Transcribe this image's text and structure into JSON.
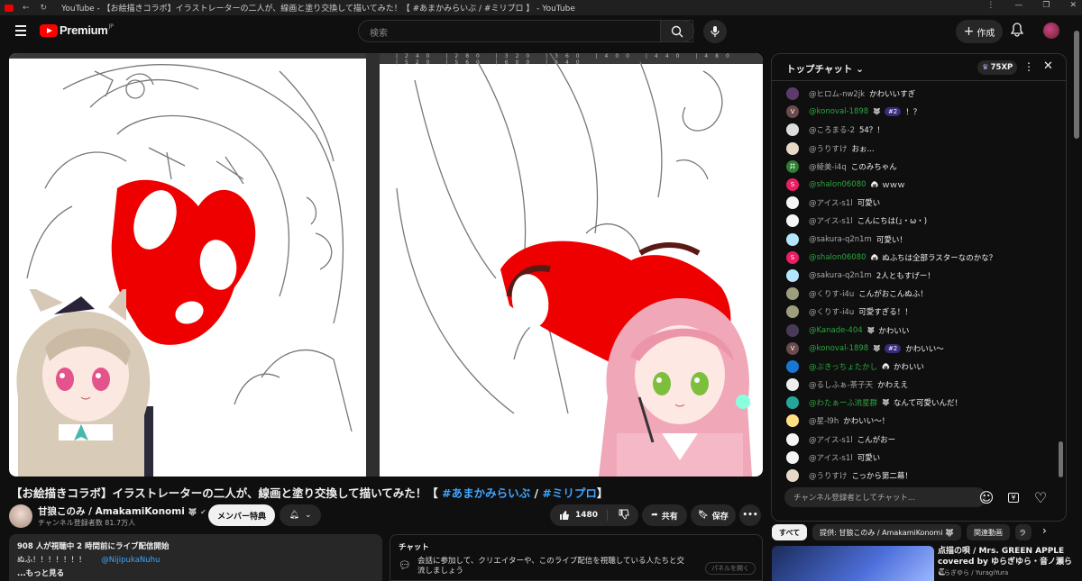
{
  "browser": {
    "tab_title": "YouTube - 【お絵描きコラボ】イラストレーターの二人が、線画と塗り交換して描いてみた！【 #あまかみらいぶ / #ミリプロ 】 - YouTube"
  },
  "header": {
    "logo_text": "Premium",
    "logo_region": "JP",
    "search_placeholder": "検索",
    "create_label": "作成"
  },
  "video": {
    "title_main": "【お絵描きコラボ】イラストレーターの二人が、線画と塗り交換して描いてみた！【",
    "title_tag1": "#あまかみらいぶ",
    "title_sep": " / ",
    "title_tag2": "#ミリプロ",
    "title_end": "】",
    "ruler_labels": "|240 |280 |320 |360 |400 |440 |480 |520 |560 |600 |640"
  },
  "channel": {
    "name": "甘狼このみ / AmakamiKonomi",
    "subs": "チャンネル登録者数 81.7万人",
    "member_label": "メンバー特典"
  },
  "actions": {
    "likes": "1480",
    "share": "共有",
    "save": "保存"
  },
  "description": {
    "live_line": "908 人が視聴中  2 時間前にライブ配信開始",
    "text": "ぬふ！！！！！！！",
    "mention": "@NijipukaNuhu",
    "more": "...もっと見る"
  },
  "chat_panel": {
    "title": "チャット",
    "message": "会話に参加して、クリエイターや、このライブ配信を視聴している人たちと交流しましょう",
    "open_label": "パネルを開く"
  },
  "live_chat": {
    "title": "トップチャット",
    "xp": "75XP",
    "input_placeholder": "チャンネル登録者としてチャット...",
    "messages": [
      {
        "author": "@ヒロム-nw2jk",
        "text": "かわいいすぎ",
        "member": false,
        "badge": "",
        "rank": "",
        "avatar_color": "#5a3b6b",
        "initial": ""
      },
      {
        "author": "@konoval-1898",
        "text": "！？",
        "member": true,
        "badge": "🐺",
        "rank": "#2",
        "avatar_color": "#6b4b4b",
        "initial": "V"
      },
      {
        "author": "@ころまる-2",
        "text": "54？！",
        "member": false,
        "badge": "",
        "rank": "",
        "avatar_color": "#dddddd",
        "initial": ""
      },
      {
        "author": "@うりすけ",
        "text": "おぉ...",
        "member": false,
        "badge": "",
        "rank": "",
        "avatar_color": "#e8d8c8",
        "initial": ""
      },
      {
        "author": "@綾美-i4q",
        "text": "このみちゃん",
        "member": false,
        "badge": "",
        "rank": "",
        "avatar_color": "#2e7d32",
        "initial": "井"
      },
      {
        "author": "@shalon06080",
        "text": "ｗｗｗ",
        "member": true,
        "badge": "🍙",
        "rank": "",
        "avatar_color": "#e91e63",
        "initial": "S"
      },
      {
        "author": "@アイス-s1l",
        "text": "可愛い",
        "member": false,
        "badge": "",
        "rank": "",
        "avatar_color": "#f5f5f5",
        "initial": ""
      },
      {
        "author": "@アイス-s1l",
        "text": "こんにちは(｣・ω・)",
        "member": false,
        "badge": "",
        "rank": "",
        "avatar_color": "#f5f5f5",
        "initial": ""
      },
      {
        "author": "@sakura-q2n1m",
        "text": "可愛い！",
        "member": false,
        "badge": "",
        "rank": "",
        "avatar_color": "#b3e5fc",
        "initial": ""
      },
      {
        "author": "@shalon06080",
        "text": "ぬふちは全部ラスターなのかな？",
        "member": true,
        "badge": "🍙",
        "rank": "",
        "avatar_color": "#e91e63",
        "initial": "S"
      },
      {
        "author": "@sakura-q2n1m",
        "text": "2人ともすげー！",
        "member": false,
        "badge": "",
        "rank": "",
        "avatar_color": "#b3e5fc",
        "initial": ""
      },
      {
        "author": "@くりす-i4u",
        "text": "こんがおこんぬふ！",
        "member": false,
        "badge": "",
        "rank": "",
        "avatar_color": "#9e9e7e",
        "initial": ""
      },
      {
        "author": "@くりす-i4u",
        "text": "可愛すぎる！！",
        "member": false,
        "badge": "",
        "rank": "",
        "avatar_color": "#9e9e7e",
        "initial": ""
      },
      {
        "author": "@Kanade-404",
        "text": "かわいい",
        "member": true,
        "badge": "🐺",
        "rank": "",
        "avatar_color": "#4a3a5a",
        "initial": ""
      },
      {
        "author": "@konoval-1898",
        "text": "かわいい〜",
        "member": true,
        "badge": "🐺",
        "rank": "#2",
        "avatar_color": "#6b4b4b",
        "initial": "V"
      },
      {
        "author": "@ぶきっちょたかし",
        "text": "かわいい",
        "member": true,
        "badge": "🍙",
        "rank": "",
        "avatar_color": "#1976d2",
        "initial": ""
      },
      {
        "author": "@るしふぁ-茶子天",
        "text": "かわええ",
        "member": false,
        "badge": "",
        "rank": "",
        "avatar_color": "#eeeeee",
        "initial": ""
      },
      {
        "author": "@わたぁーふ流星群",
        "text": "なんて可愛いんだ！",
        "member": true,
        "badge": "🐺",
        "rank": "",
        "avatar_color": "#26a69a",
        "initial": ""
      },
      {
        "author": "@星-l9h",
        "text": "かわいい〜！",
        "member": false,
        "badge": "",
        "rank": "",
        "avatar_color": "#ffe082",
        "initial": ""
      },
      {
        "author": "@アイス-s1l",
        "text": "こんがおー",
        "member": false,
        "badge": "",
        "rank": "",
        "avatar_color": "#f5f5f5",
        "initial": ""
      },
      {
        "author": "@アイス-s1l",
        "text": "可愛い",
        "member": false,
        "badge": "",
        "rank": "",
        "avatar_color": "#f5f5f5",
        "initial": ""
      },
      {
        "author": "@うりすけ",
        "text": "こっから第二幕！",
        "member": false,
        "badge": "",
        "rank": "",
        "avatar_color": "#e8d8c8",
        "initial": ""
      }
    ]
  },
  "chips": [
    "すべて",
    "提供: 甘狼このみ / AmakamiKonomi 🐺",
    "関連動画",
    "ラ"
  ],
  "recommendation": {
    "title": "点描の唄 / Mrs. GREEN APPLE covered by ゆらぎゆら・音ノ瀬らこ",
    "channel": "ゆらぎゆら / YuragiYura"
  },
  "colors": {
    "background": "#0f0f0f",
    "surface": "#272727",
    "accent_link": "#3ea6ff",
    "member_green": "#2ba640",
    "youtube_red": "#ff0000"
  }
}
